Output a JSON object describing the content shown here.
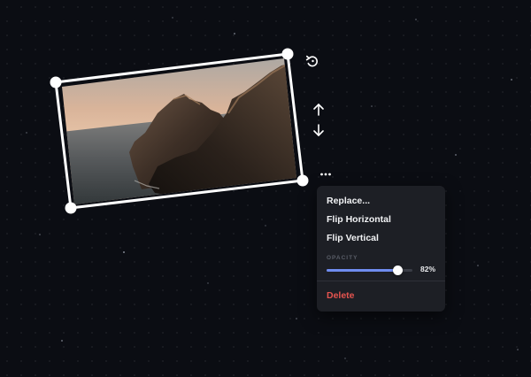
{
  "image_object": {
    "description_icon": "photo-frame"
  },
  "toolbar": {
    "rotate_icon": "rotate-icon",
    "bring_forward_icon": "arrow-up-icon",
    "send_backward_icon": "arrow-down-icon",
    "more_icon": "more-icon"
  },
  "context_menu": {
    "items": [
      {
        "label": "Replace..."
      },
      {
        "label": "Flip Horizontal"
      },
      {
        "label": "Flip Vertical"
      }
    ],
    "opacity": {
      "label": "OPACITY",
      "value": 0.82,
      "display": "82%"
    },
    "delete_label": "Delete"
  },
  "colors": {
    "background": "#0b0d13",
    "menu_bg": "#1d1f25",
    "accent": "#6f8cf0",
    "danger": "#e5544f"
  }
}
